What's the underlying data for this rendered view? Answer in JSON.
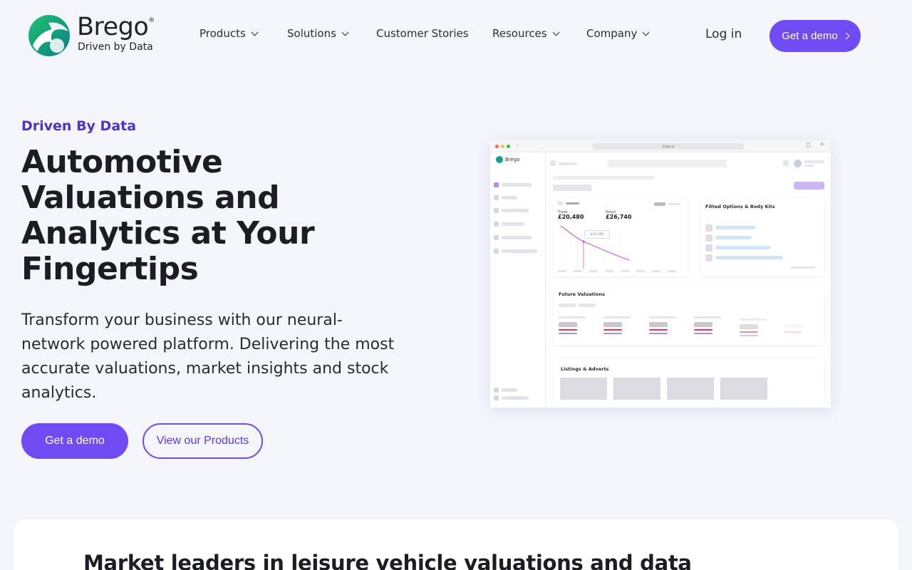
{
  "brand": {
    "name": "Brego",
    "reg_mark": "®",
    "tagline": "Driven by Data",
    "accent": "#6e4bf3",
    "heading_accent": "#4d32c9"
  },
  "nav": {
    "items": [
      {
        "label": "Products",
        "has_dropdown": true
      },
      {
        "label": "Solutions",
        "has_dropdown": true
      },
      {
        "label": "Customer Stories",
        "has_dropdown": false
      },
      {
        "label": "Resources",
        "has_dropdown": true
      },
      {
        "label": "Company",
        "has_dropdown": true
      }
    ],
    "login": "Log in",
    "demo": "Get a demo"
  },
  "hero": {
    "eyebrow": "Driven By Data",
    "title": "Automotive Valuations and Analytics at Your Fingertips",
    "subtitle": "Transform your business with our neural-network powered platform. Delivering the most accurate valuations, market insights and stock analytics.",
    "primary_button": "Get a demo",
    "secondary_button": "View our Products"
  },
  "mockup": {
    "url": "brego.ai",
    "app_name": "Brego",
    "valuation": {
      "trade_label": "Trade",
      "trade_value": "£20,480",
      "retail_label": "Retail",
      "retail_value": "£26,740",
      "tooltip": "£15,350"
    },
    "options_card_title": "Fitted Options & Body Kits",
    "future_card_title": "Future Valuations",
    "listings_card_title": "Listings & Adverts"
  },
  "section": {
    "title": "Market leaders in leisure vehicle valuations and data"
  }
}
